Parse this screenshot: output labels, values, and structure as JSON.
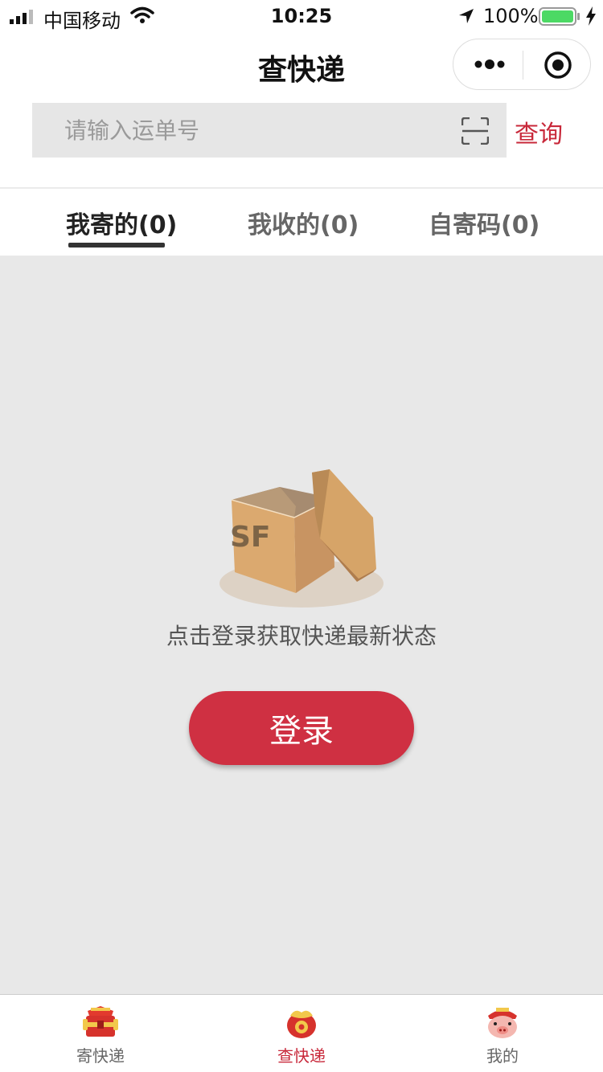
{
  "status_bar": {
    "carrier": "中国移动",
    "time": "10:25",
    "battery": "100%",
    "battery_level": 1.0,
    "icons": [
      "signal-icon",
      "wifi-icon",
      "location-arrow-icon",
      "battery-icon",
      "charging-icon"
    ]
  },
  "nav": {
    "title": "查快递",
    "icons": [
      "more-icon",
      "close-target-icon"
    ]
  },
  "search": {
    "placeholder": "请输入运单号",
    "value": "",
    "scan_icon": "scan-icon",
    "query_label": "查询"
  },
  "tabs": [
    {
      "label": "我寄的(0)",
      "active": true
    },
    {
      "label": "我收的(0)",
      "active": false
    },
    {
      "label": "自寄码(0)",
      "active": false
    }
  ],
  "empty_state": {
    "illustration": "sf-open-box",
    "message": "点击登录获取快递最新状态",
    "login_label": "登录"
  },
  "tabbar": [
    {
      "label": "寄快递",
      "icon": "send-package-icon",
      "active": false
    },
    {
      "label": "查快递",
      "icon": "track-package-icon",
      "active": true
    },
    {
      "label": "我的",
      "icon": "profile-icon",
      "active": false
    }
  ],
  "colors": {
    "accent": "#c8283a",
    "button": "#cf3042",
    "page_bg": "#e8e8e8",
    "search_bg": "#e6e6e6"
  }
}
